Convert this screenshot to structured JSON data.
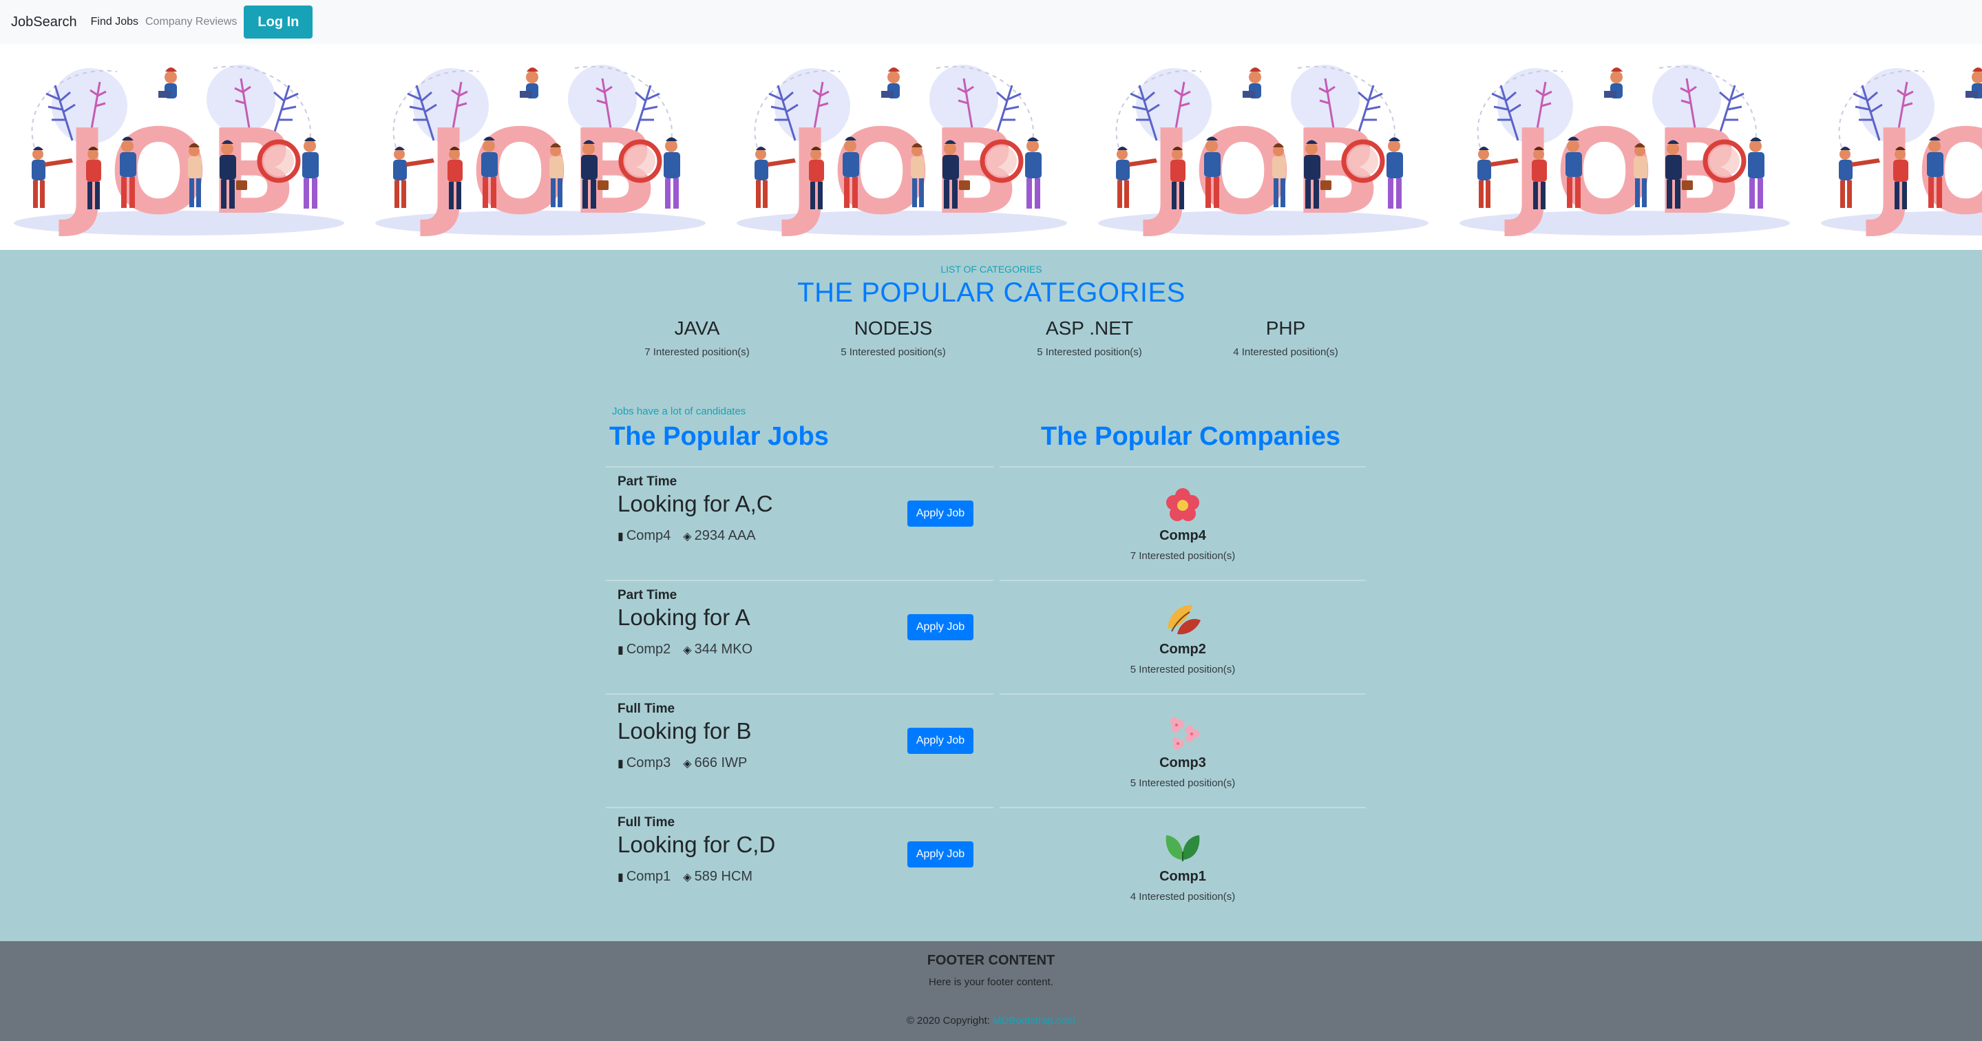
{
  "navbar": {
    "brand": "JobSearch",
    "links": [
      {
        "label": "Find Jobs"
      },
      {
        "label": "Company Reviews"
      }
    ],
    "login_label": "Log In"
  },
  "banner": {
    "word": "JOB"
  },
  "categories": {
    "eyebrow": "LIST OF CATEGORIES",
    "title": "THE POPULAR CATEGORIES",
    "items": [
      {
        "name": "JAVA",
        "count": "7 Interested position(s)"
      },
      {
        "name": "NODEJS",
        "count": "5 Interested position(s)"
      },
      {
        "name": "ASP .NET",
        "count": "5 Interested position(s)"
      },
      {
        "name": "PHP",
        "count": "4 Interested position(s)"
      }
    ]
  },
  "jobs": {
    "eyebrow": "Jobs have a lot of candidates",
    "title": "The Popular Jobs",
    "apply_label": "Apply Job",
    "items": [
      {
        "type": "Part Time",
        "title": "Looking for A,C",
        "company": "Comp4",
        "address": "2934 AAA"
      },
      {
        "type": "Part Time",
        "title": "Looking for A",
        "company": "Comp2",
        "address": "344 MKO"
      },
      {
        "type": "Full Time",
        "title": "Looking for B",
        "company": "Comp3",
        "address": "666 IWP"
      },
      {
        "type": "Full Time",
        "title": "Looking for C,D",
        "company": "Comp1",
        "address": "589 HCM"
      }
    ]
  },
  "companies": {
    "title": "The Popular Companies",
    "items": [
      {
        "name": "Comp4",
        "count": "7 Interested position(s)",
        "logo": "red-flower-icon"
      },
      {
        "name": "Comp2",
        "count": "5 Interested position(s)",
        "logo": "autumn-leaves-icon"
      },
      {
        "name": "Comp3",
        "count": "5 Interested position(s)",
        "logo": "pink-blossoms-icon"
      },
      {
        "name": "Comp1",
        "count": "4 Interested position(s)",
        "logo": "green-leaves-icon"
      }
    ]
  },
  "footer": {
    "title": "FOOTER CONTENT",
    "text": "Here is your footer content.",
    "copyright_prefix": "© 2020 Copyright:",
    "copyright_link": "MDBootstrap.com"
  },
  "colors": {
    "primary": "#007bff",
    "info": "#17a2b8",
    "main_bg": "#a8ced3",
    "footer_bg": "#6c757d"
  }
}
